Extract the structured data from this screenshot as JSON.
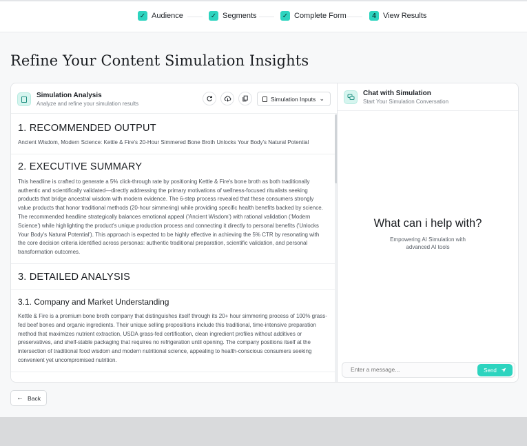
{
  "stepper": {
    "steps": [
      {
        "label": "Audience",
        "marker": "✓"
      },
      {
        "label": "Segments",
        "marker": "✓"
      },
      {
        "label": "Complete Form",
        "marker": "✓"
      },
      {
        "label": "View Results",
        "marker": "4"
      }
    ]
  },
  "page": {
    "title": "Refine Your Content Simulation Insights"
  },
  "analysis": {
    "title": "Simulation Analysis",
    "subtitle": "Analyze and refine your simulation results",
    "inputs_label": "Simulation Inputs",
    "sections": [
      {
        "heading": "1. RECOMMENDED OUTPUT",
        "text": "Ancient Wisdom, Modern Science: Kettle & Fire's 20-Hour Simmered Bone Broth Unlocks Your Body's Natural Potential"
      },
      {
        "heading": "2. EXECUTIVE SUMMARY",
        "text": "This headline is crafted to generate a 5% click-through rate by positioning Kettle & Fire's bone broth as both traditionally authentic and scientifically validated—directly addressing the primary motivations of wellness-focused ritualists seeking products that bridge ancestral wisdom with modern evidence. The 6-step process revealed that these consumers strongly value products that honor traditional methods (20-hour simmering) while providing specific health benefits backed by science. The recommended headline strategically balances emotional appeal ('Ancient Wisdom') with rational validation ('Modern Science') while highlighting the product's unique production process and connecting it directly to personal benefits ('Unlocks Your Body's Natural Potential'). This approach is expected to be highly effective in achieving the 5% CTR by resonating with the core decision criteria identified across personas: authentic traditional preparation, scientific validation, and personal transformation outcomes."
      },
      {
        "heading": "3. DETAILED ANALYSIS",
        "text": ""
      },
      {
        "heading": "3.1. Company and Market Understanding",
        "text": "Kettle & Fire is a premium bone broth company that distinguishes itself through its 20+ hour simmering process of 100% grass-fed beef bones and organic ingredients. Their unique selling propositions include this traditional, time-intensive preparation method that maximizes nutrient extraction, USDA grass-fed certification, clean ingredient profiles without additives or preservatives, and shelf-stable packaging that requires no refrigeration until opening. The company positions itself at the intersection of traditional food wisdom and modern nutritional science, appealing to health-conscious consumers seeking convenient yet uncompromised nutrition."
      }
    ]
  },
  "chat": {
    "title": "Chat with Simulation",
    "subtitle": "Start Your Simulation Conversation",
    "hero": "What can i help with?",
    "hero_sub": "Empowering AI Simulation with advanced AI tools",
    "placeholder": "Enter a message...",
    "send_label": "Send"
  },
  "nav": {
    "back_label": "Back"
  },
  "colors": {
    "accent": "#2dd4bf"
  }
}
